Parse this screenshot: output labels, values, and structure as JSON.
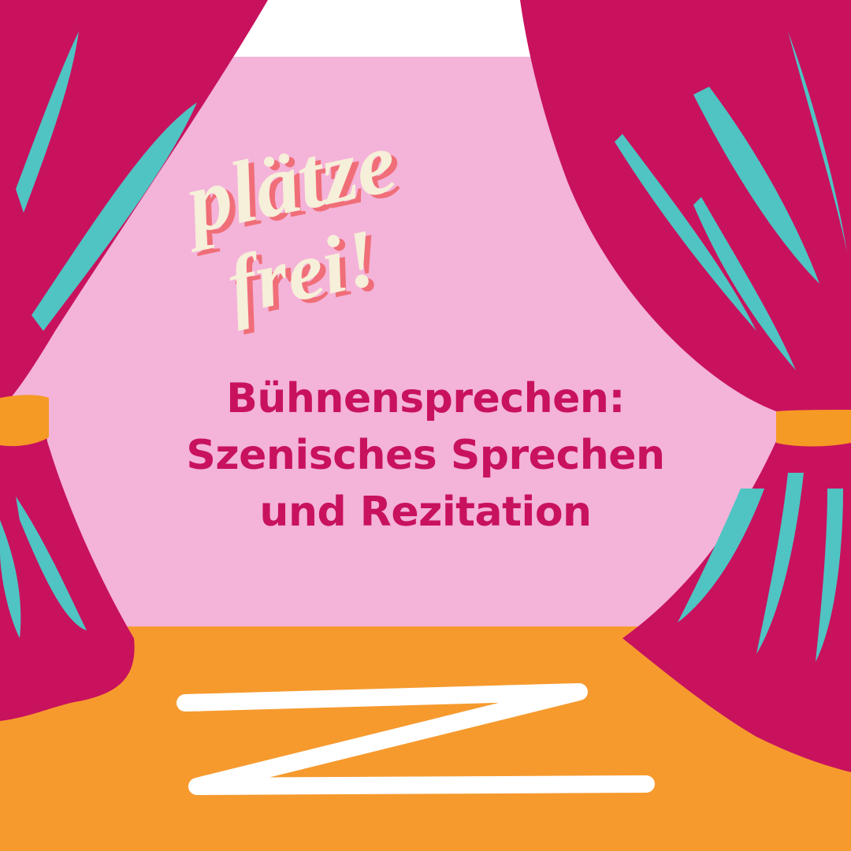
{
  "badge": {
    "line1": "plätze",
    "line2": "frei!"
  },
  "headline": {
    "line1": "Bühnensprechen:",
    "line2": "Szenisches Sprechen",
    "line3": "und Rezitation"
  },
  "colors": {
    "backdrop_pink": "#F4B3D9",
    "curtain_magenta": "#C8125E",
    "curtain_stripes_teal": "#4FC4C3",
    "stage_orange": "#F69A2E",
    "tieback_orange": "#F59A24",
    "badge_cream": "#F6EFD9",
    "badge_shadow_coral": "#F06E78",
    "headline_text": "#C8125E",
    "zigzag_white": "#FFFFFF"
  }
}
